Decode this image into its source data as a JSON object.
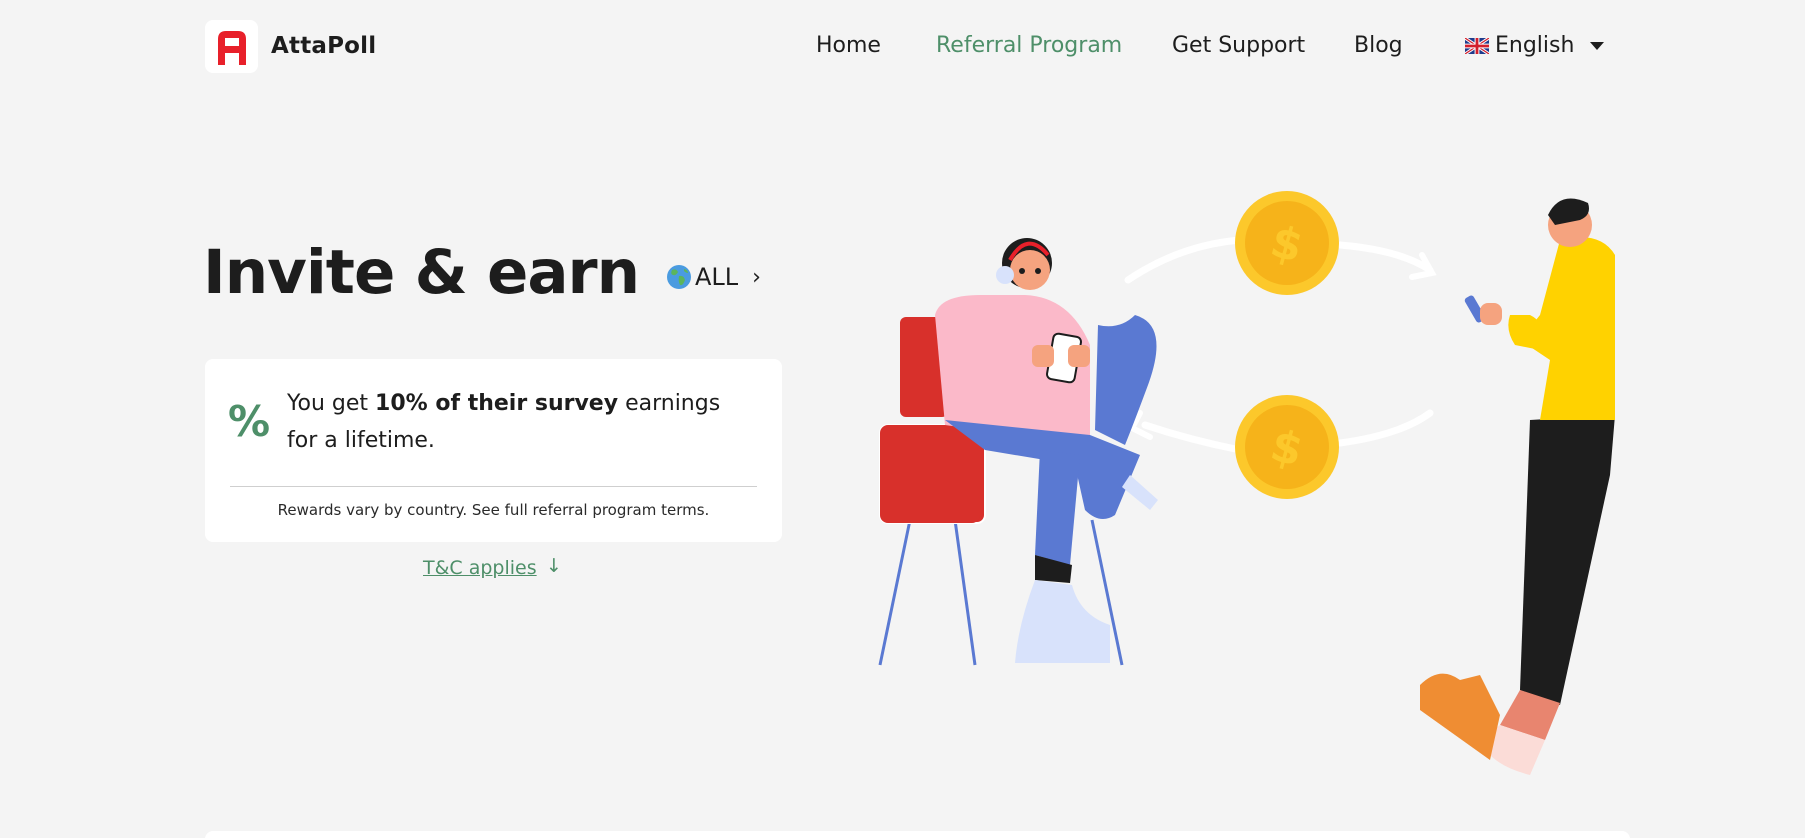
{
  "header": {
    "brand": "AttaPoll",
    "nav": [
      {
        "label": "Home"
      },
      {
        "label": "Referral Program"
      },
      {
        "label": "Get Support"
      },
      {
        "label": "Blog"
      }
    ],
    "language": "English"
  },
  "hero": {
    "title": "Invite & earn",
    "region": "ALL"
  },
  "card": {
    "icon_text": "%",
    "text_before": "You get ",
    "text_bold": "10% of their survey",
    "text_after": " earnings for a lifetime.",
    "note": "Rewards vary by country. See full referral program terms."
  },
  "terms_link": "T&C applies",
  "colors": {
    "accent": "#4e8f69",
    "background": "#f4f4f4",
    "brand_red": "#e8202a",
    "coin": "#fcc82b"
  }
}
